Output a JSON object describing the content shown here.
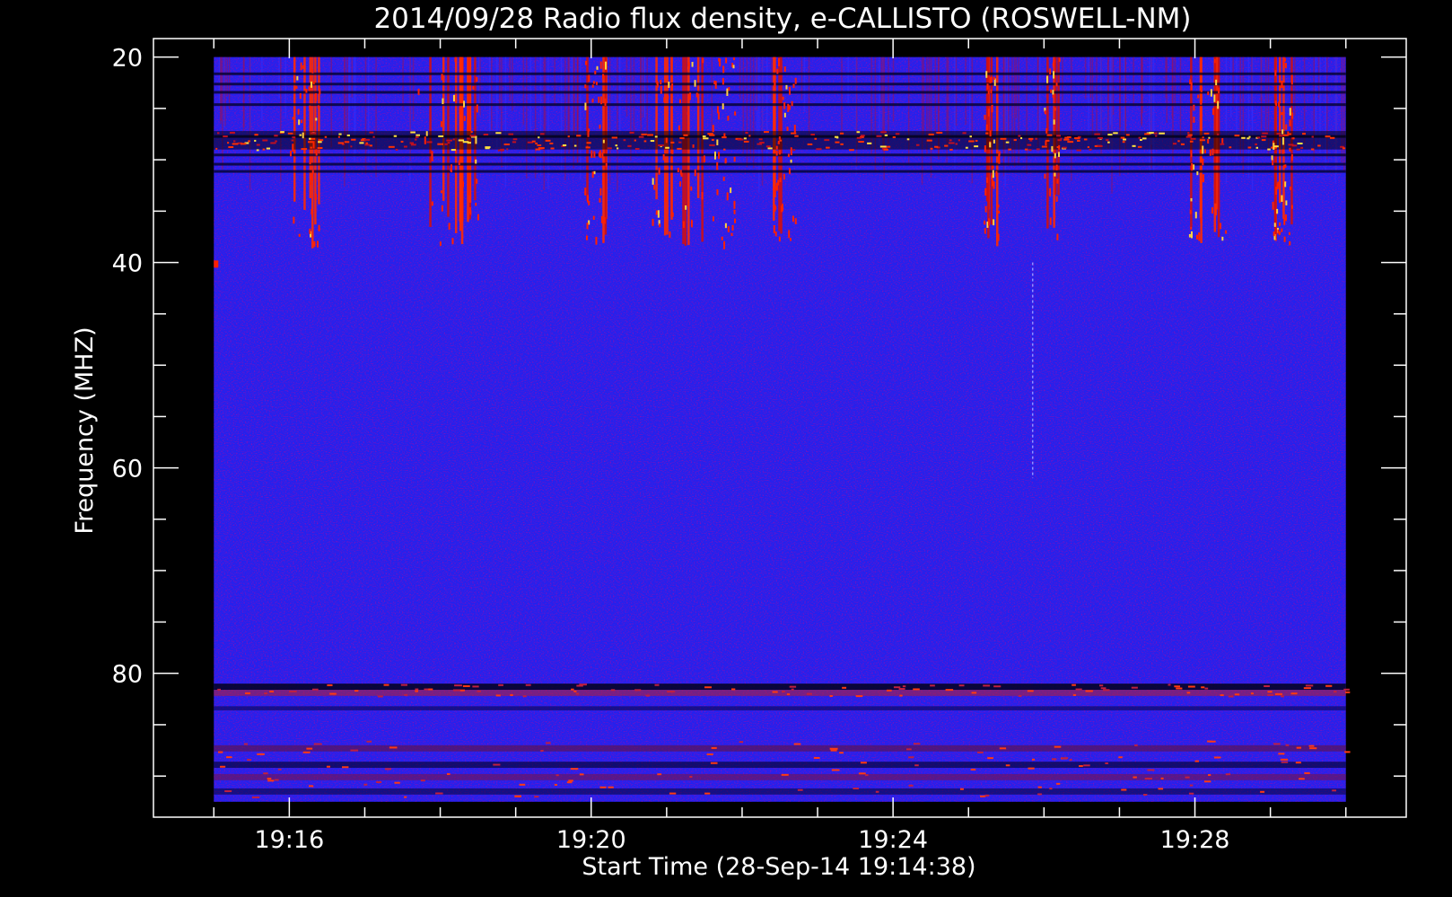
{
  "chart_data": {
    "type": "heatmap",
    "title": "2014/09/28  Radio flux density, e-CALLISTO (ROSWELL-NM)",
    "xlabel": "Start Time (28-Sep-14 19:14:38)",
    "ylabel": "Frequency (MHZ)",
    "x_ticks": [
      "19:16",
      "19:20",
      "19:24",
      "19:28"
    ],
    "x_tick_minutes": [
      16,
      20,
      24,
      28
    ],
    "x_range_minutes": [
      14.2,
      30.8
    ],
    "data_range_minutes": [
      15.0,
      30.0
    ],
    "y_ticks": [
      "20",
      "40",
      "60",
      "80"
    ],
    "y_tick_values": [
      20,
      40,
      60,
      80
    ],
    "y_range_mhz": [
      18.2,
      94.0
    ],
    "data_range_mhz": [
      20.0,
      92.5
    ],
    "y_inverted": true,
    "grid": false,
    "colormap": [
      "#000000",
      "#1010d8",
      "#2020f0",
      "#c00020",
      "#ff2000",
      "#ffe040"
    ],
    "background": "#0000000",
    "features": [
      {
        "band_mhz": [
          20,
          39
        ],
        "description": "strong interference, red/yellow vertical streaks"
      },
      {
        "band_mhz": [
          27,
          29
        ],
        "description": "bright horizontal band"
      },
      {
        "band_mhz": [
          81,
          82
        ],
        "description": "horizontal interference band"
      },
      {
        "band_mhz": [
          87,
          92
        ],
        "description": "horizontal interference bands"
      }
    ]
  }
}
